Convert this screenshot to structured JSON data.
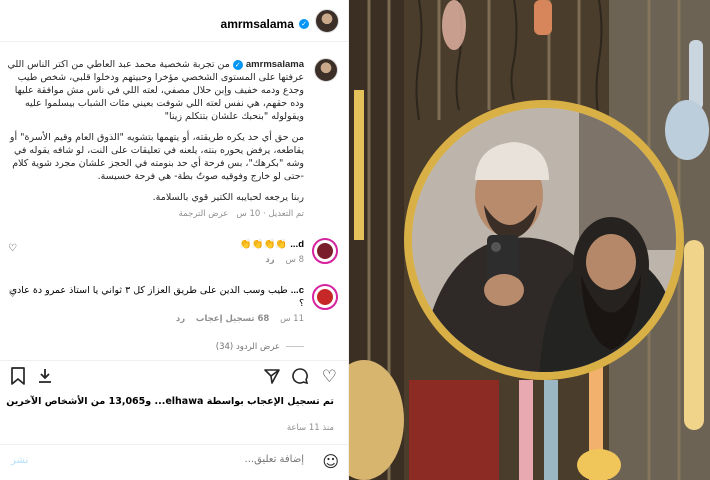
{
  "post": {
    "username": "amrmsalama",
    "verified_mark": "✓",
    "caption_user": "amrmsalama",
    "caption_p1": "من تجربة شخصية محمد عبد العاطي من اكتر الناس اللي عرفتها على المستوى الشخصي مؤخرا وحبيتهم ودخلوا قلبي، شخص طيب وجدع ودمه خفيف وإبن حلال مصفي، لعته اللي في ناس مش موافقة عليها وده حقهم، هي نفس لعته اللي شوفت بعيني مئات الشباب بيسلموا عليه ويقولوله \"بنحبك علشان بتتكلم زينا\"",
    "caption_p2": "من حق أي حد يكره طريقته، أو يتهمها بتشويه \"الذوق العام وقيم الأسرة\" أو يقاطعه، يرفض يحوره بنته، يلعنه في تعليقات على النت، لو شافه يقوله في وشه \"بكرهك\"، بس فرحة أي حد بنومته في الحجز علشان مجرد شوية كلام -حتى لو خارج وفوقيه صوتٌ بطة- هي فرحة خسيسة.",
    "caption_p3": "ربنا يرجعه لحبايبه الكتير قوي بالسلامة.",
    "caption_time": "10 س",
    "caption_edited": "تم التعديل",
    "caption_translate": "عرض الترجمة"
  },
  "comments": [
    {
      "user": "d...",
      "text": "👏👏👏👏",
      "time": "8 س",
      "reply": "رد"
    },
    {
      "user": "c...",
      "text": "طيب وسب الدين على طريق العزاز كل ٣ ثواني يا استاذ عمرو دة عادي ؟",
      "time": "11 س",
      "likes": "68 تسجيل إعجاب",
      "reply": "رد"
    }
  ],
  "view_replies": "عرض الردود (34)",
  "likes_text": "تم تسجيل الإعجاب بواسطة elhawa... و13,065 من الأشخاص الآخرين",
  "time_ago": "منذ 11 ساعة",
  "add_comment_placeholder": "إضافة تعليق...",
  "post_button": "نشر",
  "icons": {
    "like": "heart-icon",
    "comment": "comment-icon",
    "share": "share-icon",
    "save": "bookmark-icon",
    "more": "more-icon",
    "emoji": "emoji-icon"
  },
  "colors": {
    "verified": "#0095f6",
    "post_button": "#b2dffc",
    "secondary_text": "#8e8e8e"
  }
}
